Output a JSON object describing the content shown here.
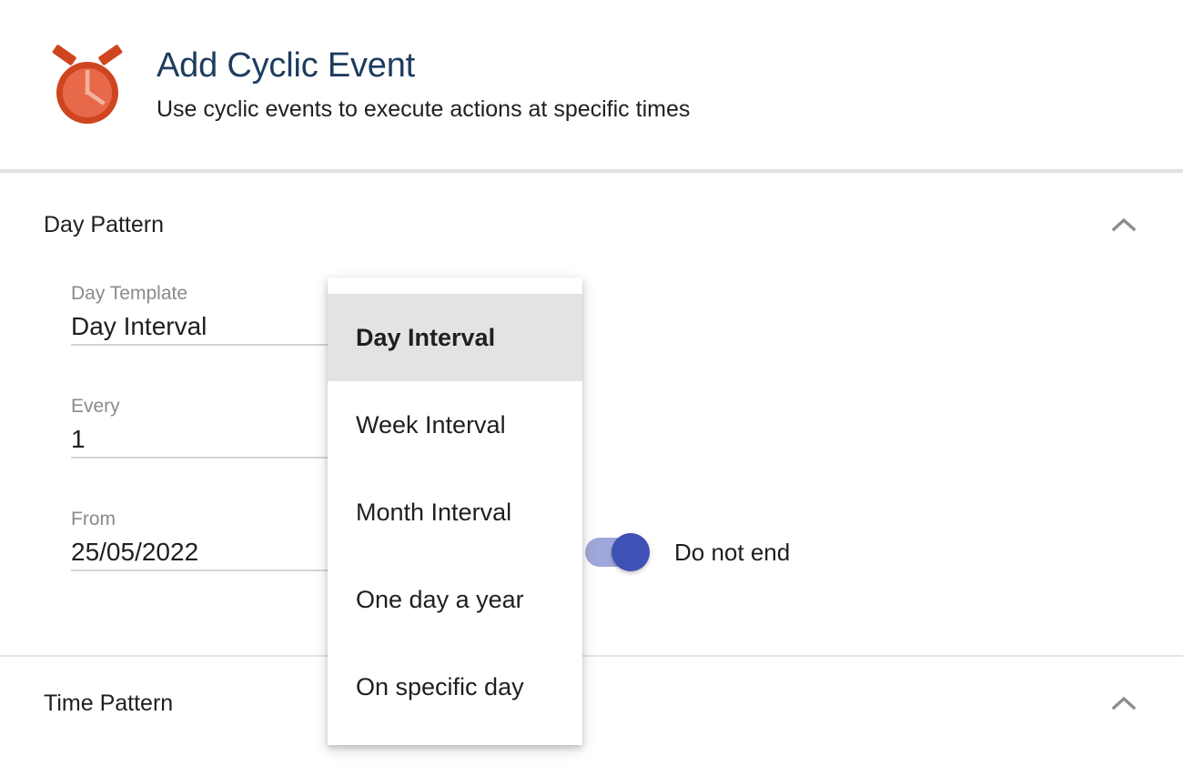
{
  "header": {
    "icon": "alarm-clock-icon",
    "title": "Add Cyclic Event",
    "subtitle": "Use cyclic events to execute actions at specific times",
    "title_color": "#1d3c5f",
    "icon_colors": {
      "outer": "#cf4520",
      "face": "#e8694a",
      "hands": "#f3a590"
    }
  },
  "sections": [
    {
      "id": "day-pattern",
      "title": "Day Pattern",
      "collapse_icon": "chevron-up-icon",
      "expanded": true
    },
    {
      "id": "time-pattern",
      "title": "Time Pattern",
      "collapse_icon": "chevron-up-icon",
      "expanded": true
    }
  ],
  "day_pattern": {
    "fields": [
      {
        "id": "day-template",
        "label": "Day Template",
        "value": "Day Interval",
        "placeholder": ""
      },
      {
        "id": "every",
        "label": "Every",
        "value": "1",
        "placeholder": ""
      },
      {
        "id": "from",
        "label": "From",
        "value": "25/05/2022",
        "placeholder": ""
      }
    ],
    "toggle": {
      "label": "Do not end",
      "state": "on",
      "track_color": "#9fa8da",
      "thumb_color": "#3f51b5"
    }
  },
  "dropdown": {
    "open": true,
    "selected": "Day Interval",
    "items": [
      {
        "label": "Day Interval",
        "selected": true
      },
      {
        "label": "Week Interval",
        "selected": false
      },
      {
        "label": "Month Interval",
        "selected": false
      },
      {
        "label": "One day a year",
        "selected": false
      },
      {
        "label": "On specific day",
        "selected": false
      }
    ]
  }
}
